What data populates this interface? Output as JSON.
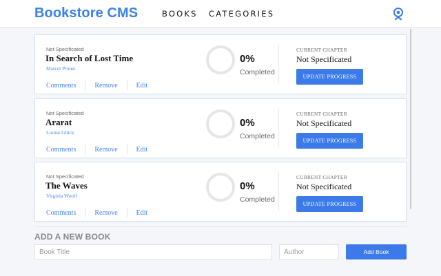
{
  "header": {
    "brand": "Bookstore CMS",
    "nav": [
      "BOOKS",
      "CATEGORIES"
    ],
    "user_icon": "user-icon",
    "accent_color": "#3b82e8"
  },
  "books": [
    {
      "genre": "Not Specificated",
      "title": "In Search of Lost Time",
      "author": "Marcel Proust",
      "actions": [
        "Comments",
        "Remove",
        "Edit"
      ],
      "progress_percent": "0%",
      "progress_label": "Completed",
      "chapter_label": "CURRENT CHAPTER",
      "chapter": "Not Specificated",
      "update_label": "UPDATE PROGRESS"
    },
    {
      "genre": "Not Specificated",
      "title": "Ararat",
      "author": "Louise Glück",
      "actions": [
        "Comments",
        "Remove",
        "Edit"
      ],
      "progress_percent": "0%",
      "progress_label": "Completed",
      "chapter_label": "CURRENT CHAPTER",
      "chapter": "Not Specificated",
      "update_label": "UPDATE PROGRESS"
    },
    {
      "genre": "Not Specificated",
      "title": "The Waves",
      "author": "Virginia Woolf",
      "actions": [
        "Comments",
        "Remove",
        "Edit"
      ],
      "progress_percent": "0%",
      "progress_label": "Completed",
      "chapter_label": "CURRENT CHAPTER",
      "chapter": "Not Specificated",
      "update_label": "UPDATE PROGRESS"
    }
  ],
  "form": {
    "title": "ADD A NEW BOOK",
    "title_placeholder": "Book Title",
    "author_placeholder": "Author",
    "submit_label": "Add Book"
  }
}
